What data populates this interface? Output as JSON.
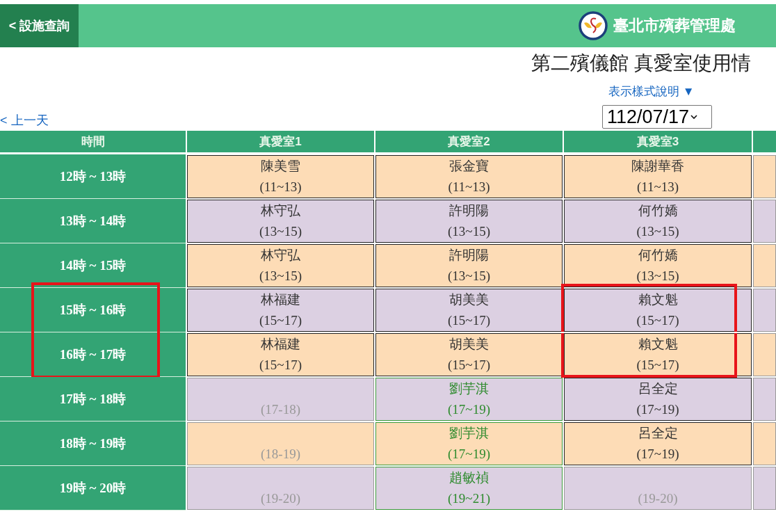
{
  "header": {
    "back_button": "< 設施查詢",
    "org_name": "臺北市殯葬管理處"
  },
  "title": "第二殯儀館 真愛室使用情",
  "legend_link": "表示樣式說明 ▼",
  "date_select": {
    "value": "112/07/17"
  },
  "prev_day_link": "< 上一天",
  "table": {
    "time_header": "時間",
    "columns": [
      "真愛室1",
      "真愛室2",
      "真愛室3"
    ],
    "rows": [
      {
        "time": "12時 ~ 13時",
        "highlighted": false,
        "cells": [
          {
            "kind": "booked",
            "name": "陳美雪",
            "range": "(11~13)",
            "highlighted": false
          },
          {
            "kind": "booked",
            "name": "張金寶",
            "range": "(11~13)",
            "highlighted": false
          },
          {
            "kind": "booked",
            "name": "陳謝華香",
            "range": "(11~13)",
            "highlighted": false
          }
        ]
      },
      {
        "time": "13時 ~ 14時",
        "highlighted": false,
        "cells": [
          {
            "kind": "booked",
            "name": "林守弘",
            "range": "(13~15)",
            "highlighted": false
          },
          {
            "kind": "booked",
            "name": "許明陽",
            "range": "(13~15)",
            "highlighted": false
          },
          {
            "kind": "booked",
            "name": "何竹嬌",
            "range": "(13~15)",
            "highlighted": false
          }
        ]
      },
      {
        "time": "14時 ~ 15時",
        "highlighted": false,
        "cells": [
          {
            "kind": "booked",
            "name": "林守弘",
            "range": "(13~15)",
            "highlighted": false
          },
          {
            "kind": "booked",
            "name": "許明陽",
            "range": "(13~15)",
            "highlighted": false
          },
          {
            "kind": "booked",
            "name": "何竹嬌",
            "range": "(13~15)",
            "highlighted": false
          }
        ]
      },
      {
        "time": "15時 ~ 16時",
        "highlighted": true,
        "cells": [
          {
            "kind": "booked",
            "name": "林福建",
            "range": "(15~17)",
            "highlighted": false
          },
          {
            "kind": "booked",
            "name": "胡美美",
            "range": "(15~17)",
            "highlighted": false
          },
          {
            "kind": "booked",
            "name": "賴文魁",
            "range": "(15~17)",
            "highlighted": true
          }
        ]
      },
      {
        "time": "16時 ~ 17時",
        "highlighted": true,
        "cells": [
          {
            "kind": "booked",
            "name": "林福建",
            "range": "(15~17)",
            "highlighted": false
          },
          {
            "kind": "booked",
            "name": "胡美美",
            "range": "(15~17)",
            "highlighted": false
          },
          {
            "kind": "booked",
            "name": "賴文魁",
            "range": "(15~17)",
            "highlighted": true
          }
        ]
      },
      {
        "time": "17時 ~ 18時",
        "highlighted": false,
        "cells": [
          {
            "kind": "empty",
            "range": "(17-18)",
            "highlighted": false
          },
          {
            "kind": "pending",
            "name": "劉芋淇",
            "range": "(17~19)",
            "highlighted": false
          },
          {
            "kind": "booked",
            "name": "呂全定",
            "range": "(17~19)",
            "highlighted": false
          }
        ]
      },
      {
        "time": "18時 ~ 19時",
        "highlighted": false,
        "cells": [
          {
            "kind": "empty",
            "range": "(18-19)",
            "highlighted": false
          },
          {
            "kind": "pending",
            "name": "劉芋淇",
            "range": "(17~19)",
            "highlighted": false
          },
          {
            "kind": "booked",
            "name": "呂全定",
            "range": "(17~19)",
            "highlighted": false
          }
        ]
      },
      {
        "time": "19時 ~ 20時",
        "highlighted": false,
        "cells": [
          {
            "kind": "empty",
            "range": "(19-20)",
            "highlighted": false
          },
          {
            "kind": "pending",
            "name": "趙敏禎",
            "range": "(19~21)",
            "highlighted": false
          },
          {
            "kind": "empty",
            "range": "(19-20)",
            "highlighted": false
          }
        ]
      }
    ]
  }
}
